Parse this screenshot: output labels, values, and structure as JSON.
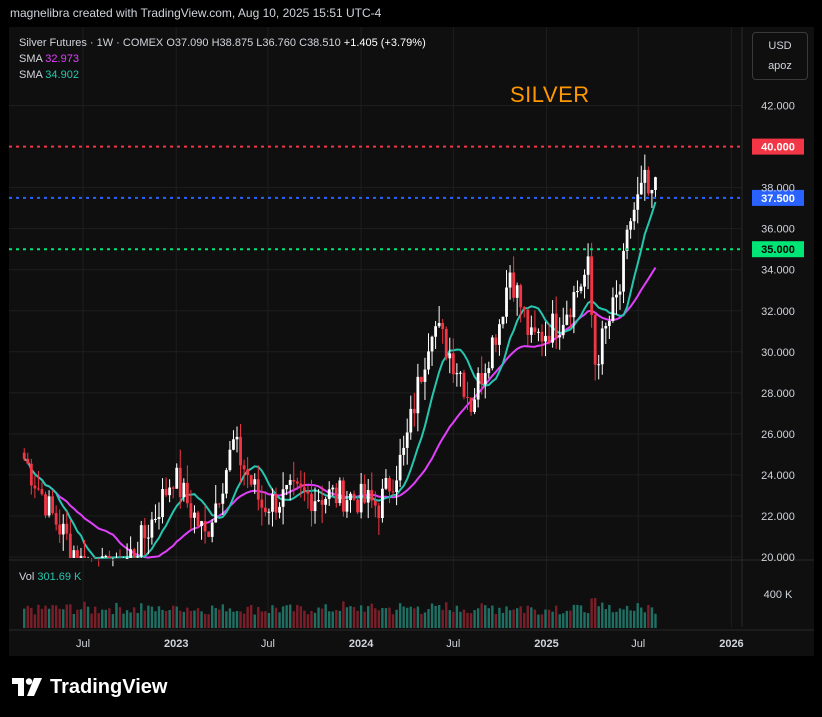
{
  "creator_line": "magnelibra created with TradingView.com, Aug 10, 2025 15:51 UTC-4",
  "legend": {
    "symbol": "Silver Futures · 1W · COMEX",
    "open_label": "O",
    "open": "37.090",
    "high_label": "H",
    "high": "38.875",
    "low_label": "L",
    "low": "36.760",
    "close_label": "C",
    "close": "38.510",
    "change": "+1.405 (+3.79%)",
    "sma1_label": "SMA",
    "sma1_value": "32.973",
    "sma2_label": "SMA",
    "sma2_value": "34.902"
  },
  "chart_title": "SILVER",
  "currency": {
    "code": "USD",
    "unit": "apoz"
  },
  "volume": {
    "label": "Vol",
    "value": "301.69 K",
    "scale_label": "400 K"
  },
  "brand": {
    "name": "TradingView",
    "logo_icon": "tradingview-logo-icon"
  },
  "colors": {
    "up_candle": "#ffffff",
    "down_candle": "#f23645",
    "sma_slow": "#e040fb",
    "sma_fast": "#26c6b0",
    "level_red": "#f23645",
    "level_blue": "#2962ff",
    "level_green": "#00e676",
    "title": "#ff9800"
  },
  "chart_data": {
    "type": "candlestick",
    "symbol": "Silver Futures",
    "timeframe": "1W",
    "exchange": "COMEX",
    "y_axis": {
      "range": [
        20.0,
        43.0
      ],
      "ticks": [
        "20.000",
        "22.000",
        "24.000",
        "26.000",
        "28.000",
        "30.000",
        "32.000",
        "34.000",
        "36.000",
        "38.000",
        "42.000"
      ]
    },
    "x_axis": {
      "ticks": [
        {
          "label": "Jul",
          "date": "2022-07-01"
        },
        {
          "label": "2023",
          "date": "2023-01-01"
        },
        {
          "label": "Jul",
          "date": "2023-07-01"
        },
        {
          "label": "2024",
          "date": "2024-01-01"
        },
        {
          "label": "Jul",
          "date": "2024-07-01"
        },
        {
          "label": "2025",
          "date": "2025-01-01"
        },
        {
          "label": "Jul",
          "date": "2025-07-01"
        },
        {
          "label": "2026",
          "date": "2026-01-01"
        }
      ]
    },
    "price_levels": [
      {
        "value": 40.0,
        "label": "40.000",
        "color": "#f23645"
      },
      {
        "value": 37.5,
        "label": "37.500",
        "color": "#2962ff"
      },
      {
        "value": 35.0,
        "label": "35.000",
        "color": "#00e676"
      }
    ],
    "weekly_closes_approx": [
      {
        "date": "2022-03-07",
        "close": 24.8
      },
      {
        "date": "2022-05-02",
        "close": 22.0
      },
      {
        "date": "2022-07-04",
        "close": 19.5
      },
      {
        "date": "2022-09-05",
        "close": 19.2
      },
      {
        "date": "2022-10-31",
        "close": 21.0
      },
      {
        "date": "2022-12-26",
        "close": 24.0
      },
      {
        "date": "2023-02-27",
        "close": 21.0
      },
      {
        "date": "2023-04-24",
        "close": 25.5
      },
      {
        "date": "2023-06-19",
        "close": 22.5
      },
      {
        "date": "2023-08-14",
        "close": 23.0
      },
      {
        "date": "2023-10-09",
        "close": 23.0
      },
      {
        "date": "2023-12-04",
        "close": 23.0
      },
      {
        "date": "2024-02-05",
        "close": 22.5
      },
      {
        "date": "2024-03-25",
        "close": 25.0
      },
      {
        "date": "2024-05-20",
        "close": 31.5
      },
      {
        "date": "2024-07-15",
        "close": 29.0
      },
      {
        "date": "2024-08-05",
        "close": 27.5
      },
      {
        "date": "2024-09-30",
        "close": 31.5
      },
      {
        "date": "2024-10-21",
        "close": 34.0
      },
      {
        "date": "2024-12-02",
        "close": 30.5
      },
      {
        "date": "2025-01-27",
        "close": 31.5
      },
      {
        "date": "2025-03-24",
        "close": 34.0
      },
      {
        "date": "2025-04-07",
        "close": 29.5
      },
      {
        "date": "2025-05-26",
        "close": 33.0
      },
      {
        "date": "2025-06-16",
        "close": 36.5
      },
      {
        "date": "2025-07-14",
        "close": 38.2
      },
      {
        "date": "2025-07-28",
        "close": 37.1
      },
      {
        "date": "2025-08-04",
        "close": 38.51
      }
    ],
    "sma_values_last": {
      "sma_slow": 32.973,
      "sma_fast": 34.902
    },
    "grid": true,
    "legend_position": "top-left"
  }
}
